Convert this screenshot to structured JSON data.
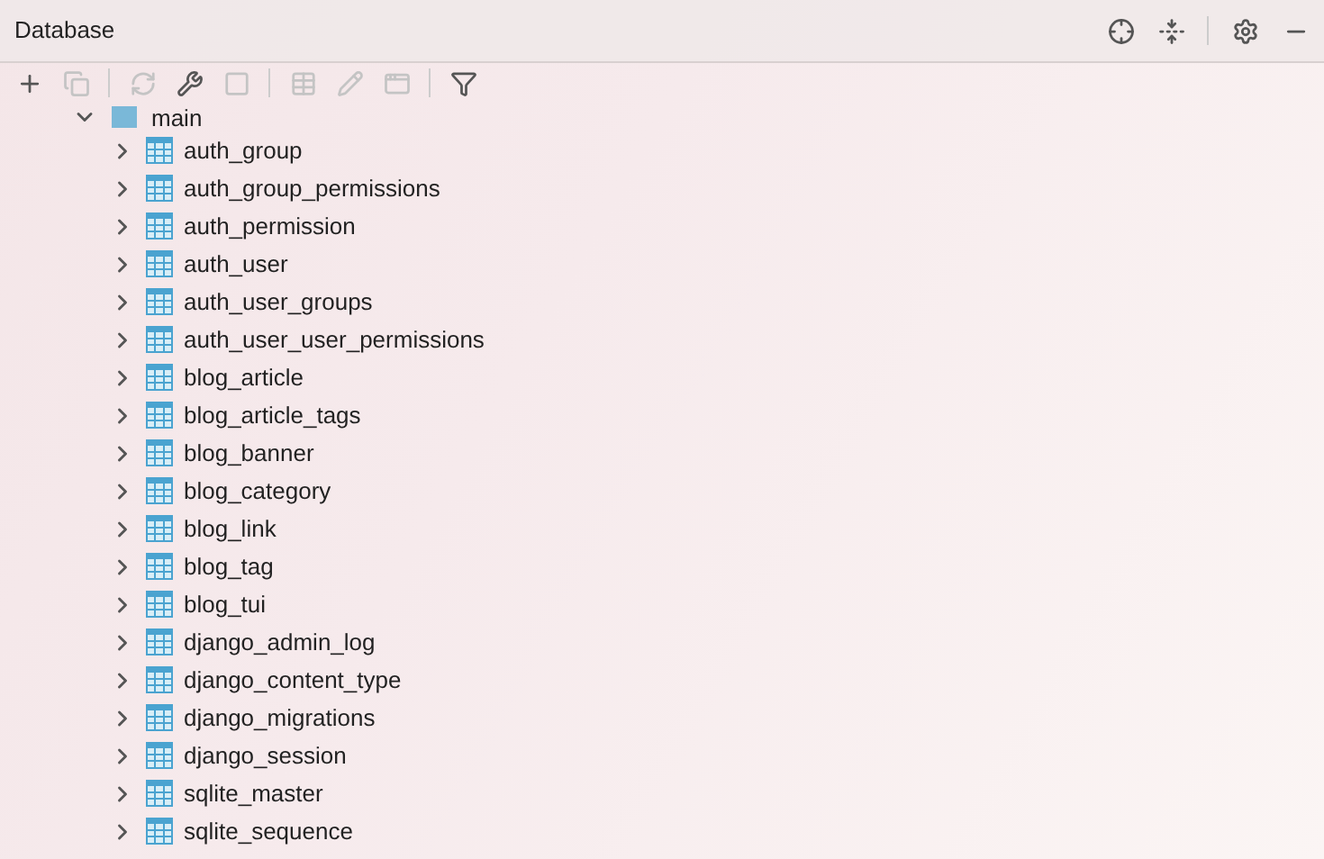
{
  "panel": {
    "title": "Database"
  },
  "tree": {
    "label": "main",
    "expanded": true,
    "children": [
      {
        "label": "auth_group",
        "expanded": false
      },
      {
        "label": "auth_group_permissions",
        "expanded": false
      },
      {
        "label": "auth_permission",
        "expanded": false
      },
      {
        "label": "auth_user",
        "expanded": false
      },
      {
        "label": "auth_user_groups",
        "expanded": false
      },
      {
        "label": "auth_user_user_permissions",
        "expanded": false
      },
      {
        "label": "blog_article",
        "expanded": false
      },
      {
        "label": "blog_article_tags",
        "expanded": false
      },
      {
        "label": "blog_banner",
        "expanded": false
      },
      {
        "label": "blog_category",
        "expanded": false
      },
      {
        "label": "blog_link",
        "expanded": false
      },
      {
        "label": "blog_tag",
        "expanded": false
      },
      {
        "label": "blog_tui",
        "expanded": false
      },
      {
        "label": "django_admin_log",
        "expanded": false
      },
      {
        "label": "django_content_type",
        "expanded": false
      },
      {
        "label": "django_migrations",
        "expanded": false
      },
      {
        "label": "django_session",
        "expanded": false
      },
      {
        "label": "sqlite_master",
        "expanded": false
      },
      {
        "label": "sqlite_sequence",
        "expanded": false
      }
    ]
  }
}
